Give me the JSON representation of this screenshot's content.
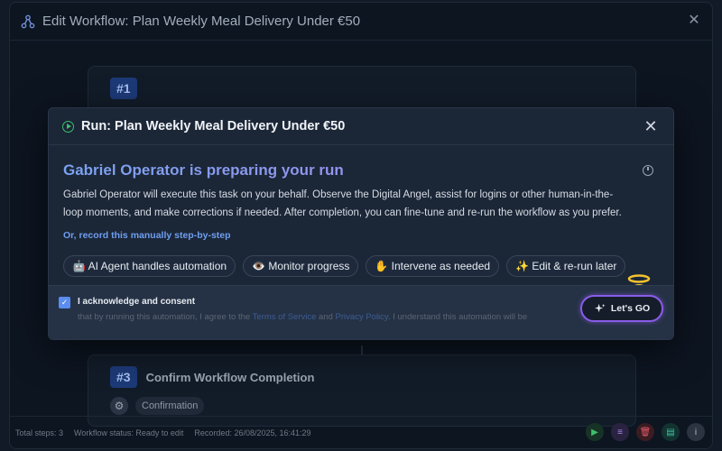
{
  "outer": {
    "title": "Edit Workflow: Plan Weekly Meal Delivery Under €50",
    "step1": {
      "number": "#1"
    },
    "step3": {
      "number": "#3",
      "title": "Confirm Workflow Completion",
      "chip": "Confirmation"
    },
    "footer": {
      "total_steps": "Total steps: 3",
      "status": "Workflow status: Ready to edit",
      "recorded": "Recorded: 26/08/2025, 16:41:29"
    }
  },
  "run_modal": {
    "title": "Run: Plan Weekly Meal Delivery Under €50",
    "heading": "Gabriel Operator is preparing your run",
    "description": "Gabriel Operator will execute this task on your behalf. Observe the Digital Angel, assist for logins or other human-in-the-loop moments, and make corrections if needed. After completion, you can fine-tune and re-run the workflow as you prefer.",
    "manual_link": "Or, record this manually step-by-step",
    "chips": [
      "🤖 AI Agent handles automation",
      "👁️ Monitor progress",
      "✋ Intervene as needed",
      "✨ Edit & re-run later"
    ],
    "consent": {
      "checked": true,
      "title": "I acknowledge and consent",
      "text_before": "that by running this automation, I agree to the ",
      "terms_link": "Terms of Service",
      "and": " and ",
      "privacy_link": "Privacy Policy",
      "text_after": ". I understand this automation will be"
    },
    "go_button": "Let's GO"
  },
  "colors": {
    "accent_purple": "#8a5ce8",
    "link_blue": "#6f9ff0",
    "run_green": "#3fbf6d"
  }
}
